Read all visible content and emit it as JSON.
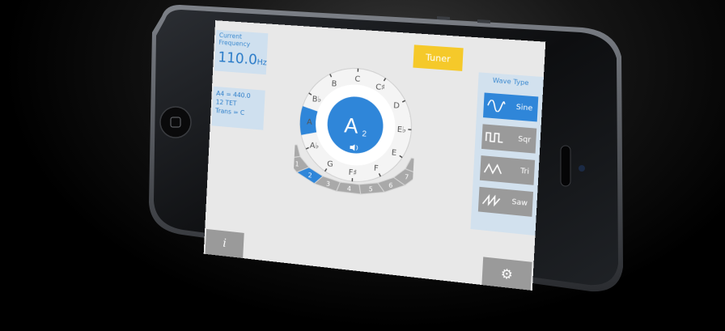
{
  "frequency_panel": {
    "title": "Current Frequency",
    "value": "110.0",
    "unit": "Hz"
  },
  "settings_panel": {
    "lines": [
      "A4 = 440.0",
      "12 TET",
      "Trans = C"
    ]
  },
  "tuner_tab": {
    "label": "Tuner"
  },
  "wave_panel": {
    "title": "Wave Type",
    "options": [
      {
        "label": "Sine",
        "icon": "sine-wave-icon",
        "active": true
      },
      {
        "label": "Sqr",
        "icon": "square-wave-icon",
        "active": false
      },
      {
        "label": "Tri",
        "icon": "triangle-wave-icon",
        "active": false
      },
      {
        "label": "Saw",
        "icon": "saw-wave-icon",
        "active": false
      }
    ]
  },
  "dial": {
    "current_note": "A",
    "current_octave": "2",
    "notes": [
      "C",
      "C♯",
      "D",
      "E♭",
      "E",
      "F",
      "F♯",
      "G",
      "A♭",
      "A",
      "B♭",
      "B"
    ],
    "octaves": [
      "0",
      "1",
      "2",
      "3",
      "4",
      "5",
      "6",
      "7",
      "8"
    ],
    "selected_octave": "2",
    "selected_note": "A",
    "speaker_icon": "speaker-icon"
  },
  "info_button": {
    "label": "i",
    "icon": "info-icon"
  },
  "settings_button": {
    "icon": "gear-icon"
  },
  "colors": {
    "accent": "#2f86d9",
    "tab": "#f5c92a",
    "panel": "#cfe0ef",
    "button": "#9a9a9a"
  }
}
